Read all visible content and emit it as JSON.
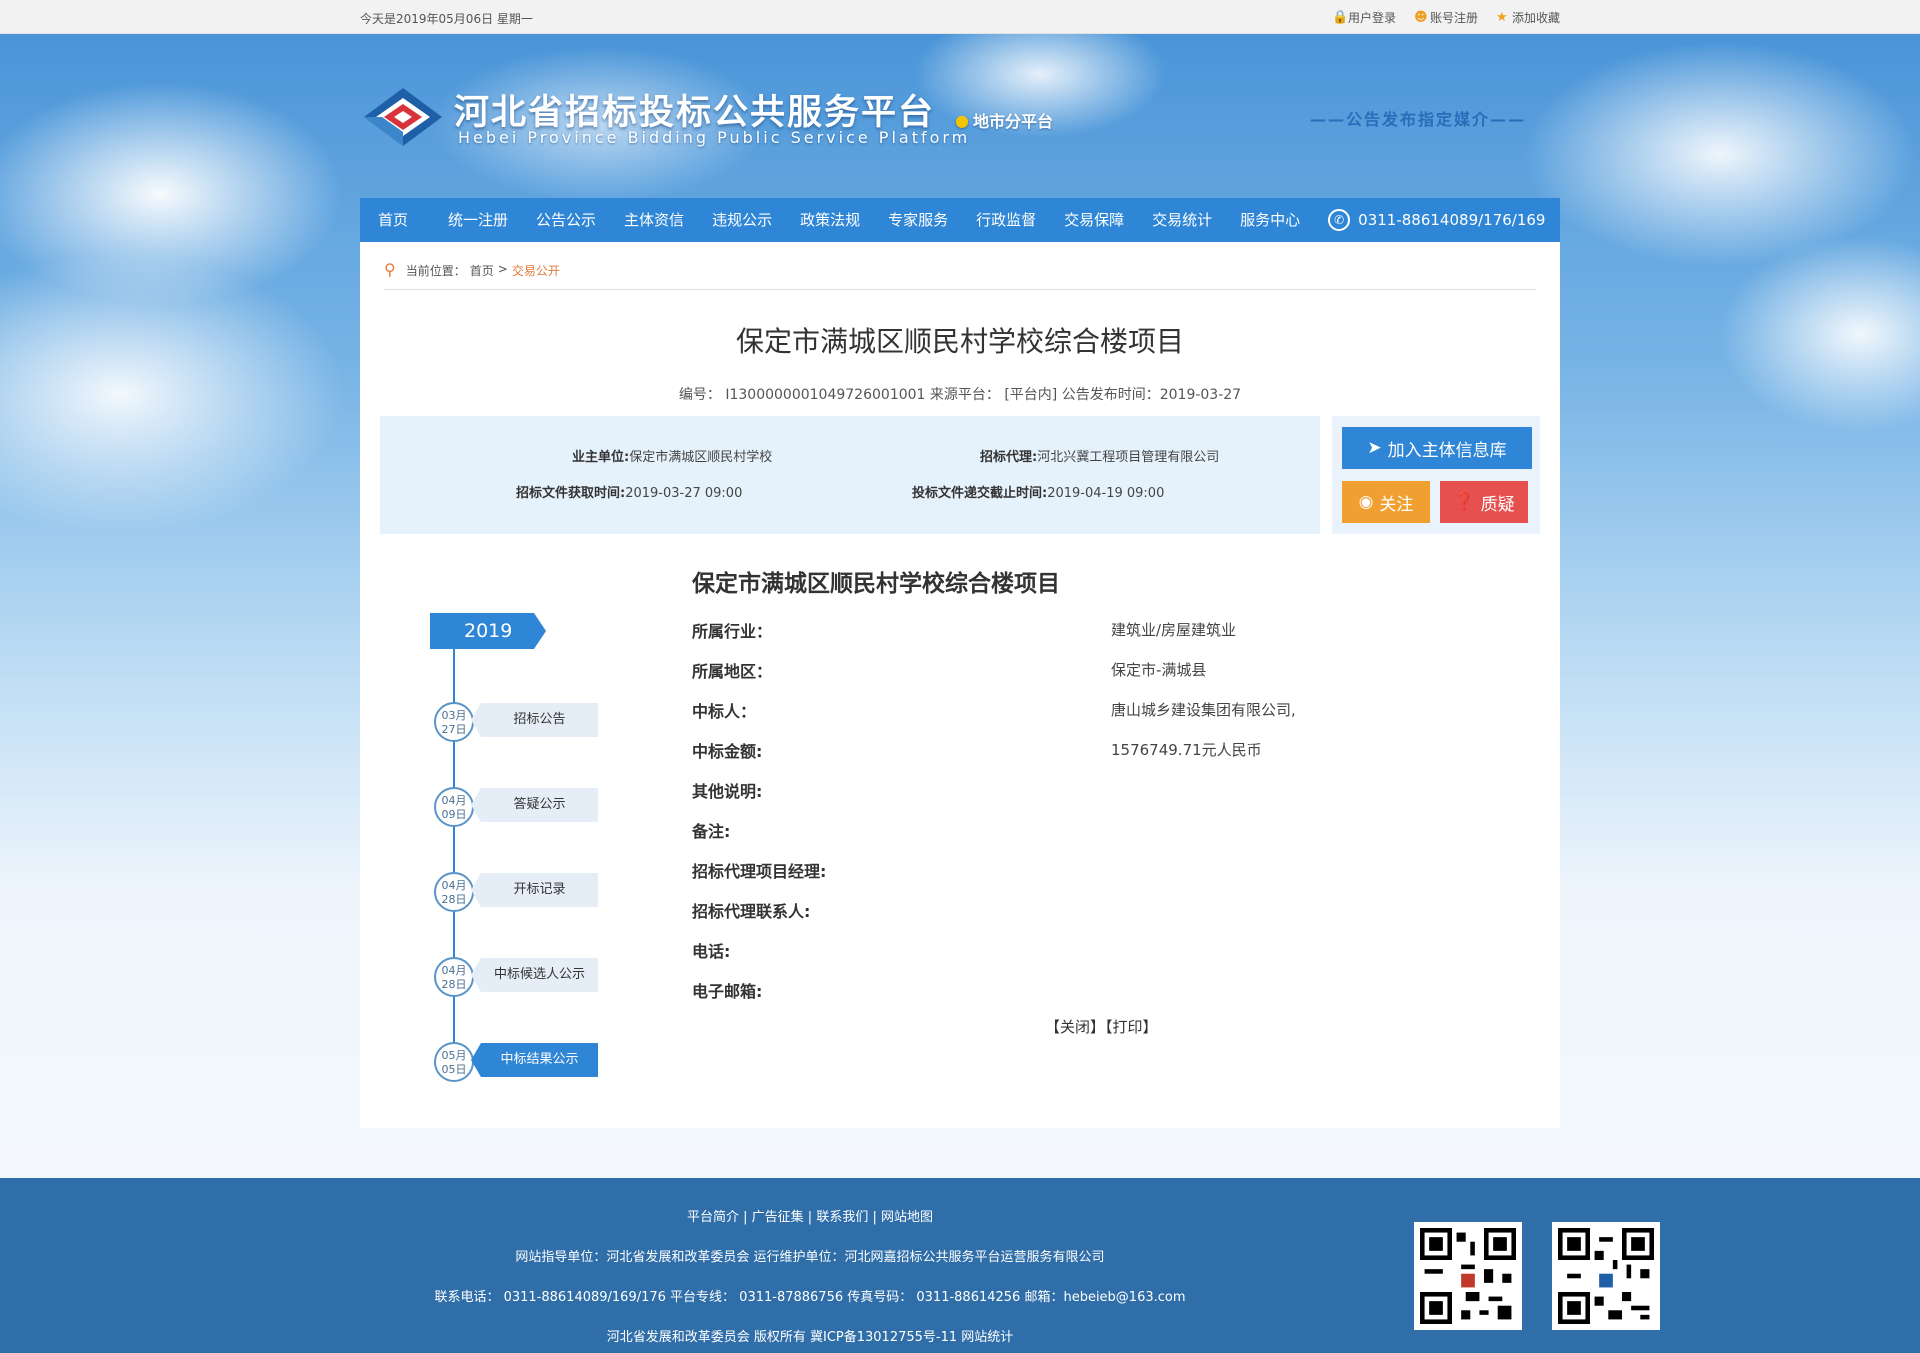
{
  "topbar": {
    "date": "今天是2019年05月06日 星期一",
    "login": "用户登录",
    "register": "账号注册",
    "favorite": "添加收藏"
  },
  "header": {
    "title": "河北省招标投标公共服务平台",
    "subtitle": "Hebei Province Bidding Public Service Platform",
    "city_platform": "地市分平台",
    "media": "——公告发布指定媒介——"
  },
  "nav": {
    "items": [
      "首页",
      "统一注册",
      "公告公示",
      "主体资信",
      "违规公示",
      "政策法规",
      "专家服务",
      "行政监督",
      "交易保障",
      "交易统计",
      "服务中心"
    ],
    "phone": "0311-88614089/176/169"
  },
  "breadcrumb": {
    "prefix": "当前位置：",
    "home": "首页",
    "sep": ">",
    "current": "交易公开"
  },
  "project": {
    "title": "保定市满城区顺民村学校综合楼项目",
    "meta": "编号： I13000000010497260010​01    来源平台： [平台内]    公告发布时间：2019-03-27"
  },
  "info": {
    "owner_label": "业主单位:",
    "owner": "保定市满城区顺民村学校",
    "agent_label": "招标代理:",
    "agent": "河北兴冀工程项目管理有限公司",
    "doc_time_label": "招标文件获取时间:",
    "doc_time": "2019-03-27 09:00",
    "deadline_label": "投标文件递交截止时间:",
    "deadline": "2019-04-19 09:00"
  },
  "buttons": {
    "add": "加入主体信息库",
    "follow": "关注",
    "ask": "质疑"
  },
  "detail": {
    "title": "保定市满城区顺民村学校综合楼项目",
    "rows": [
      {
        "label": "所属行业：",
        "value": "建筑业/房屋建筑业"
      },
      {
        "label": "所属地区：",
        "value": "保定市-满城县"
      },
      {
        "label": "中标人：",
        "value": "唐山城乡建设集团有限公司,"
      },
      {
        "label": "中标金额:",
        "value": "1576749.71元人民币"
      },
      {
        "label": "其他说明:",
        "value": ""
      },
      {
        "label": "备注:",
        "value": ""
      },
      {
        "label": "招标代理项目经理:",
        "value": ""
      },
      {
        "label": "招标代理联系人:",
        "value": ""
      },
      {
        "label": "电话:",
        "value": ""
      },
      {
        "label": "电子邮箱:",
        "value": ""
      }
    ],
    "close": "【关闭】",
    "print": "【打印】"
  },
  "timeline": {
    "year": "2019",
    "items": [
      {
        "month": "03月",
        "day": "27日",
        "label": "招标公告"
      },
      {
        "month": "04月",
        "day": "09日",
        "label": "答疑公示"
      },
      {
        "month": "04月",
        "day": "28日",
        "label": "开标记录"
      },
      {
        "month": "04月",
        "day": "28日",
        "label": "中标候选人公示"
      },
      {
        "month": "05月",
        "day": "05日",
        "label": "中标结果公示"
      }
    ]
  },
  "footer": {
    "links": "平台简介   |   广告征集   |   联系我们   |   网站地图",
    "guide": "网站指导单位：河北省发展和改革委员会    运行维护单位：河北网嘉招标公共服务平台运营服务有限公司",
    "contact": "联系电话： 0311-88614089/169/176    平台专线： 0311-87886756    传真号码： 0311-88614256    邮箱：hebeieb@163.com",
    "copyright": "河北省发展和改革委员会 版权所有    冀ICP备13012755号-11    网站统计"
  },
  "colors": {
    "nav_blue": "#2f86d6",
    "footer_blue": "#2f6ea8",
    "follow_orange": "#f0a030",
    "ask_red": "#e6504f",
    "crumb_orange": "#e07a3a"
  }
}
